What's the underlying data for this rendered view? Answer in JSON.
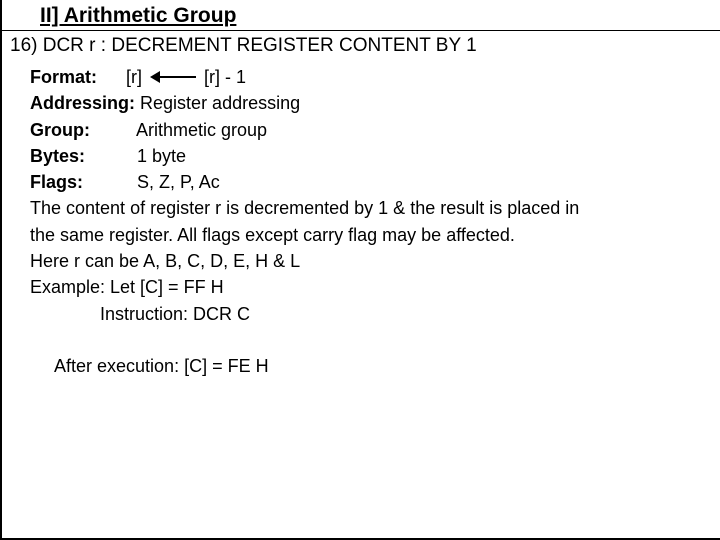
{
  "header": "II] Arithmetic Group",
  "subhead": "16) DCR r : DECREMENT REGISTER CONTENT BY 1",
  "labels": {
    "format": "Format:",
    "addressing": "Addressing:",
    "group": "Group:",
    "bytes": "Bytes:",
    "flags": "Flags:"
  },
  "format": {
    "left": "[r]",
    "right": "[r] - 1"
  },
  "addressing": "Register addressing",
  "group": "Arithmetic group",
  "bytes": "1 byte",
  "flags": "S, Z, P, Ac",
  "desc1": "The content of register r is decremented by 1 & the result is placed in",
  "desc2": "the same register. All flags except carry flag may be affected.",
  "desc3": "Here r can be A, B, C, D, E, H & L",
  "example_line": "Example: Let [C] = FF H",
  "instruction_line": "Instruction: DCR C",
  "after_exec": "After execution: [C] = FE H"
}
